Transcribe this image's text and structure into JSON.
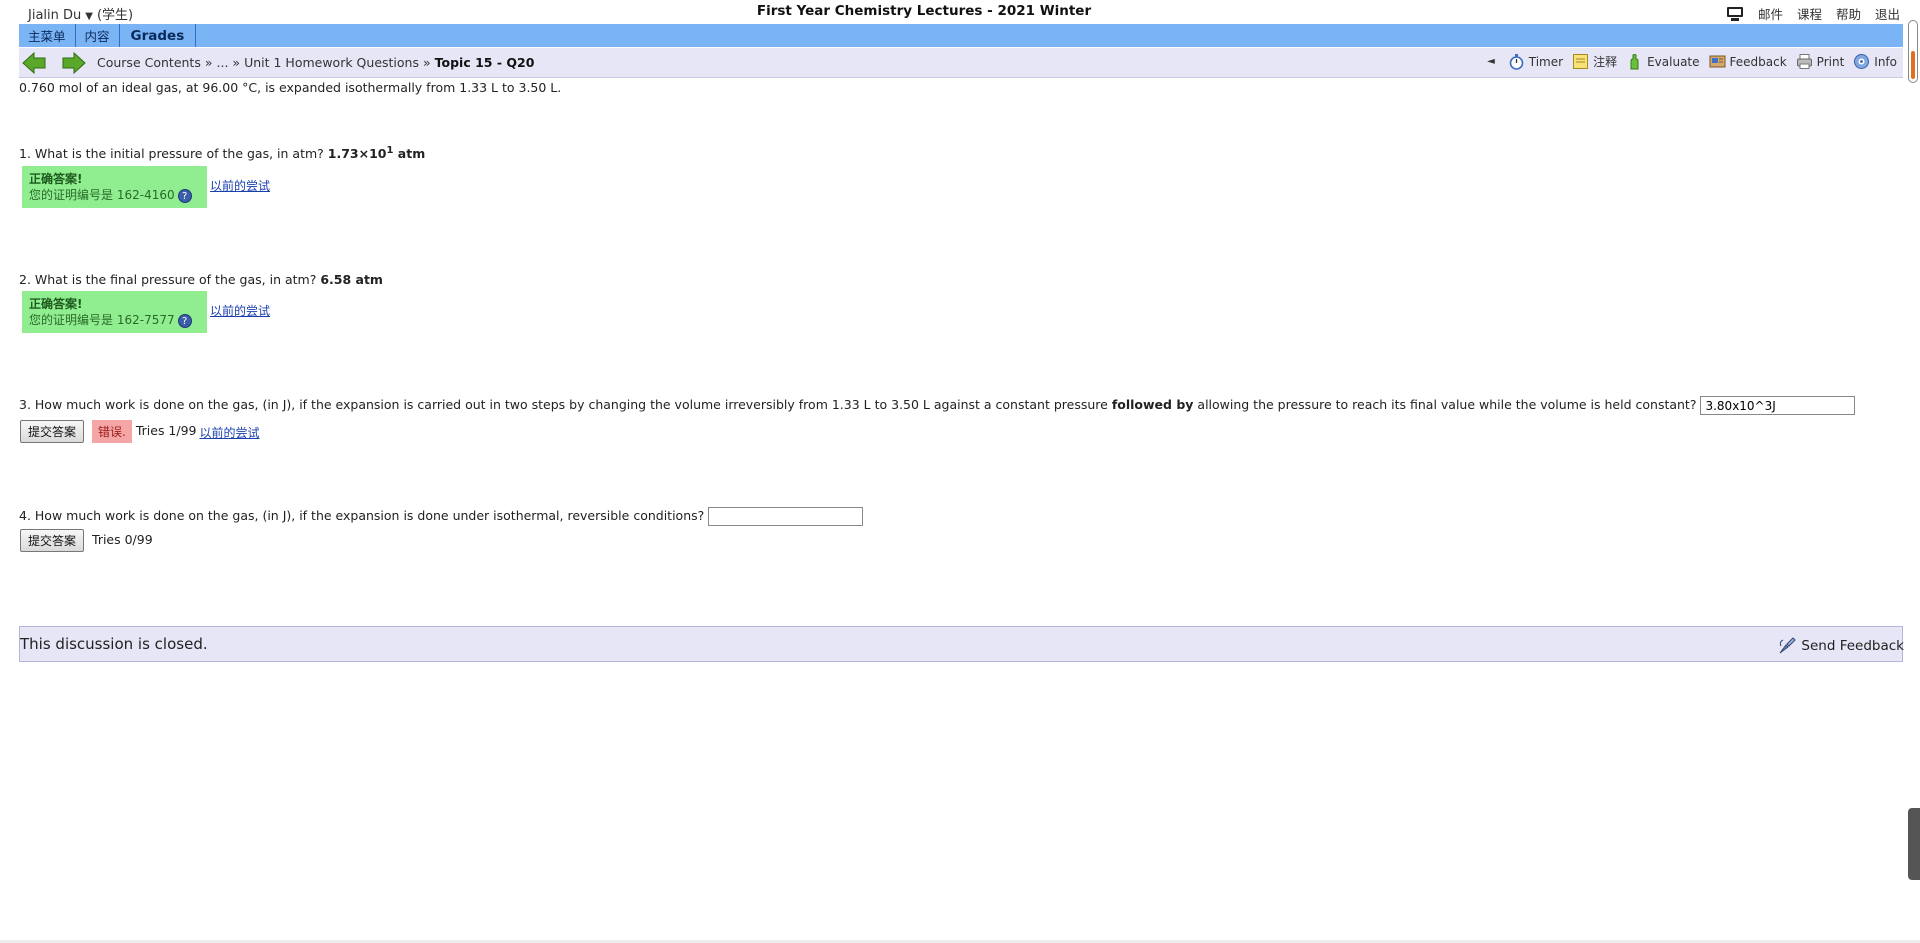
{
  "header": {
    "user_name": "Jialin Du",
    "user_role": "(学生)",
    "course_title": "First Year Chemistry Lectures - 2021 Winter",
    "links": [
      "邮件",
      "课程",
      "帮助",
      "退出"
    ]
  },
  "menu": {
    "items": [
      "主菜单",
      "内容",
      "Grades"
    ]
  },
  "nav": {
    "crumbs": [
      "Course Contents",
      "...",
      "Unit 1 Homework Questions"
    ],
    "separator": "»",
    "current": "Topic 15 - Q20",
    "collapse": "◄",
    "tools": {
      "timer": "Timer",
      "notes": "注释",
      "evaluate": "Evaluate",
      "feedback": "Feedback",
      "print": "Print",
      "info": "Info"
    }
  },
  "content": {
    "intro": "0.760 mol of an ideal gas, at 96.00 °C, is expanded isothermally from 1.33 L to 3.50 L.",
    "q1": {
      "text": "1. What is the initial pressure of the gas, in atm?",
      "answer_mantissa": "1.73×10",
      "answer_exp": "1",
      "answer_unit": " atm",
      "status": "正确答案!",
      "cert_label": "您的证明编号是",
      "cert_number": "162-4160",
      "prev_link": "以前的尝试"
    },
    "q2": {
      "text": "2. What is the final pressure of the gas, in atm?",
      "answer": "6.58 atm",
      "status": "正确答案!",
      "cert_label": "您的证明编号是",
      "cert_number": "162-7577",
      "prev_link": "以前的尝试"
    },
    "q3": {
      "text_a": "3. How much work is done on the gas, (in J), if the expansion is carried out in two steps by changing the volume irreversibly from 1.33 L to 3.50 L against a constant pressure",
      "text_bold": "followed by",
      "text_b": "allowing the pressure to reach its final value while the volume is held constant?",
      "input_value": "3.80x10^3J",
      "submit": "提交答案",
      "status": "错误.",
      "tries": "Tries 1/99",
      "prev_link": "以前的尝试"
    },
    "q4": {
      "text": "4. How much work is done on the gas, (in J), if the expansion is done under isothermal, reversible conditions?",
      "input_value": "",
      "submit": "提交答案",
      "tries": "Tries 0/99"
    }
  },
  "discussion": {
    "closed_text": "This discussion is closed.",
    "send_feedback": "Send Feedback"
  },
  "colors": {
    "menu_bar": "#7ab4f5",
    "nav_bar": "#e6e6f6",
    "correct": "#90ee90",
    "wrong": "#f4a6a6"
  }
}
